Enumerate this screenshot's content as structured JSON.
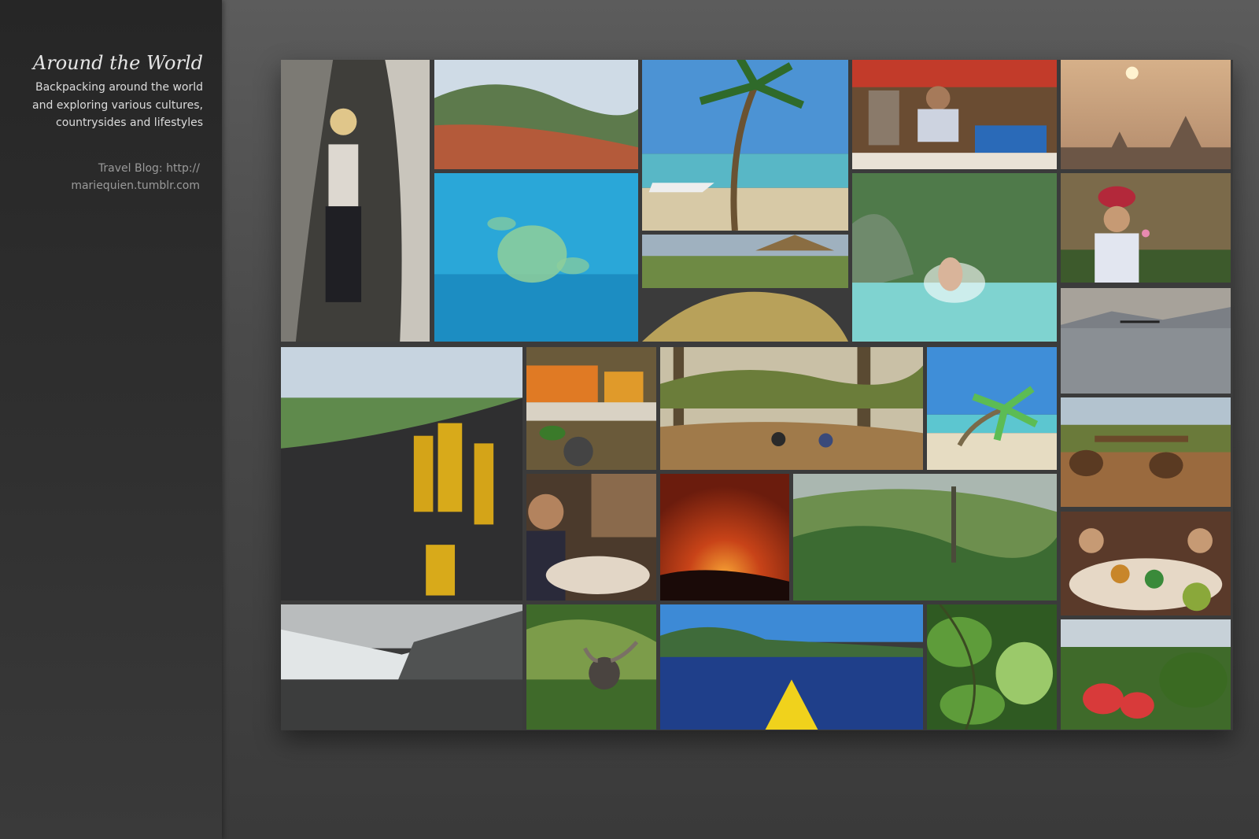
{
  "sidebar": {
    "title": "Around the World",
    "tagline_lines": [
      "Backpacking around the world",
      "and exploring various cultures,",
      "countrysides and lifestyles"
    ],
    "blog_prefix": "Travel Blog: http://",
    "blog_domain": "mariequien.tumblr.com"
  },
  "gallery": {
    "photos": [
      {
        "name": "photo-cave-hiker",
        "colors": [
          "#3f3e3a",
          "#7c7a74",
          "#c9c5bc"
        ],
        "kind": "cave"
      },
      {
        "name": "photo-crater-lake",
        "colors": [
          "#cfdbe6",
          "#5d7a4c",
          "#b45a3a"
        ],
        "kind": "hills"
      },
      {
        "name": "photo-sea-turtle",
        "colors": [
          "#2aa7d8",
          "#1782b9",
          "#8fcf9a"
        ],
        "kind": "underwater"
      },
      {
        "name": "photo-palm-beach-boats",
        "colors": [
          "#4c93d4",
          "#58b7c6",
          "#d7c9a6"
        ],
        "kind": "beach"
      },
      {
        "name": "photo-coconut-pile",
        "colors": [
          "#9fb1bf",
          "#6e8a44",
          "#b8a15a"
        ],
        "kind": "village"
      },
      {
        "name": "photo-market-vendor",
        "colors": [
          "#6a4c32",
          "#c23b2a",
          "#e9e2d6"
        ],
        "kind": "shop"
      },
      {
        "name": "photo-river-splash",
        "colors": [
          "#4f7a4a",
          "#6f8a6c",
          "#7fd3d0"
        ],
        "kind": "river"
      },
      {
        "name": "photo-sunrise-temples",
        "colors": [
          "#d6b089",
          "#b28a6b",
          "#6c5646"
        ],
        "kind": "sunrise"
      },
      {
        "name": "photo-village-elder",
        "colors": [
          "#7b6a4a",
          "#b3283a",
          "#3d5a2c"
        ],
        "kind": "portrait"
      },
      {
        "name": "photo-lake-fishermen",
        "colors": [
          "#a7a29a",
          "#6b6e73",
          "#8a8f94"
        ],
        "kind": "lake"
      },
      {
        "name": "photo-volcano-boarders",
        "colors": [
          "#c7d4e0",
          "#5f8a4c",
          "#2f2f30"
        ],
        "kind": "volcano"
      },
      {
        "name": "photo-fruit-stall",
        "colors": [
          "#6a5a3a",
          "#e07a24",
          "#d9d2c4"
        ],
        "kind": "fruit"
      },
      {
        "name": "photo-forest-trail",
        "colors": [
          "#c9c0a6",
          "#6b7d3a",
          "#a07a4a"
        ],
        "kind": "forest"
      },
      {
        "name": "photo-tropical-palms",
        "colors": [
          "#3f8ed8",
          "#5cbc54",
          "#e6dcc2"
        ],
        "kind": "palms"
      },
      {
        "name": "photo-ox-cart",
        "colors": [
          "#b3c3cf",
          "#6a7a3a",
          "#9a6a3e"
        ],
        "kind": "oxcart"
      },
      {
        "name": "photo-coconut-seller",
        "colors": [
          "#4b3a2c",
          "#8a6a4c",
          "#e2d6c6"
        ],
        "kind": "seller"
      },
      {
        "name": "photo-lava-glow",
        "colors": [
          "#6b1c0d",
          "#c84318",
          "#f6a234"
        ],
        "kind": "lava"
      },
      {
        "name": "photo-rainforest",
        "colors": [
          "#aab7b0",
          "#3c6b32",
          "#6d8f4e"
        ],
        "kind": "jungle"
      },
      {
        "name": "photo-street-food",
        "colors": [
          "#5a3a2a",
          "#c8862a",
          "#e6d8c6"
        ],
        "kind": "food"
      },
      {
        "name": "photo-glacier-trek",
        "colors": [
          "#b9bcbd",
          "#e2e6e7",
          "#3c3d3d"
        ],
        "kind": "glacier"
      },
      {
        "name": "photo-water-buffalo",
        "colors": [
          "#7c9c4a",
          "#3f6a2a",
          "#4a4440"
        ],
        "kind": "buffalo"
      },
      {
        "name": "photo-kayak-lake",
        "colors": [
          "#3d8ad6",
          "#3f6b3a",
          "#1f3f8a"
        ],
        "kind": "kayak"
      },
      {
        "name": "photo-green-leaves",
        "colors": [
          "#5e9c3a",
          "#2f5a22",
          "#9bc96a"
        ],
        "kind": "leaves"
      },
      {
        "name": "photo-watermelon-field",
        "colors": [
          "#c7d1d8",
          "#3f6a2a",
          "#d83a3a"
        ],
        "kind": "melon"
      }
    ]
  }
}
